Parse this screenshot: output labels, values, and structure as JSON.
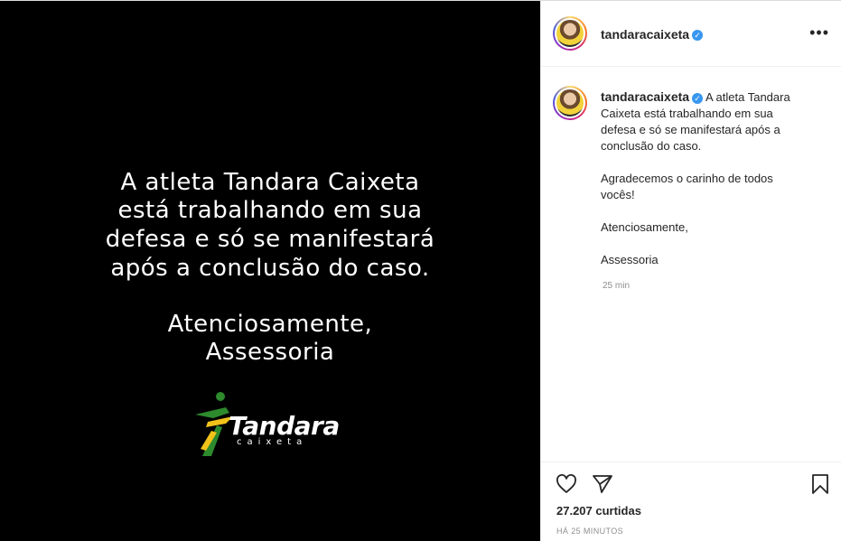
{
  "post": {
    "image_lines": [
      "A atleta Tandara Caixeta",
      "está trabalhando em sua",
      "defesa e só se manifestará",
      "após a conclusão do caso.",
      "Atenciosamente,",
      "Assessoria"
    ],
    "logo_word": "Tandara",
    "logo_sub": "caixeta"
  },
  "header": {
    "username": "tandaracaixeta",
    "verified_glyph": "✓",
    "more_label": "•••"
  },
  "caption": {
    "username": "tandaracaixeta",
    "text_lines": [
      "A atleta Tandara",
      "Caixeta está trabalhando em sua",
      "defesa e só se manifestará após a",
      "conclusão do caso."
    ],
    "paragraphs": [
      "Agradecemos o carinho de todos vocês!",
      "Atenciosamente,",
      "Assessoria"
    ],
    "time": "25 min"
  },
  "actions": {
    "like_icon": "heart-icon",
    "share_icon": "paper-plane-icon",
    "save_icon": "bookmark-icon",
    "likes_text": "27.207 curtidas",
    "date_text": "HÁ 25 MINUTOS"
  },
  "colors": {
    "verified": "#3897f0",
    "muted": "#8e8e8e",
    "text": "#262626",
    "logo_green": "#2d8a2d",
    "logo_yellow": "#f2c21a"
  }
}
